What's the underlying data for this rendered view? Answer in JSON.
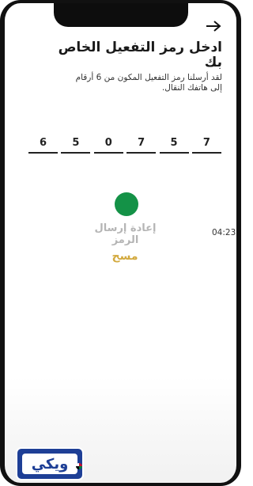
{
  "header": {
    "title": "ادخل رمز التفعيل الخاص بك",
    "subtitle": "لقد أرسلنا رمز التفعيل المكون من 6 أرقام إلى هاتفك النقال."
  },
  "code": {
    "digits": [
      "6",
      "5",
      "0",
      "7",
      "5",
      "7"
    ]
  },
  "actions": {
    "resend_label": "إعادة إرسال الرمز",
    "timer": "04:23",
    "clear_label": "مسح"
  },
  "watermark": {
    "text": "ويكي"
  },
  "colors": {
    "accent_green": "#149247",
    "clear_gold": "#d3aa3f",
    "resend_gray": "#b5b5b5",
    "logo_blue": "#1e3f96"
  }
}
